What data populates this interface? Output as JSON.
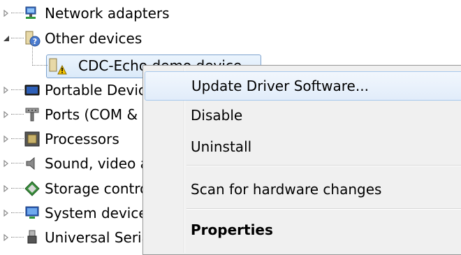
{
  "tree": {
    "items": [
      {
        "label": "Network adapters",
        "icon": "network-adapter-icon",
        "expanded": false
      },
      {
        "label": "Other devices",
        "icon": "unknown-device-icon",
        "expanded": true
      },
      {
        "label": "CDC-Echo demo device",
        "icon": "warning-device-icon",
        "child": true
      },
      {
        "label": "Portable Devices",
        "icon": "portable-device-icon",
        "expanded": false
      },
      {
        "label": "Ports (COM & LPT)",
        "icon": "port-icon",
        "expanded": false
      },
      {
        "label": "Processors",
        "icon": "processor-icon",
        "expanded": false
      },
      {
        "label": "Sound, video and game controllers",
        "icon": "speaker-icon",
        "expanded": false
      },
      {
        "label": "Storage controllers",
        "icon": "storage-icon",
        "expanded": false
      },
      {
        "label": "System devices",
        "icon": "system-device-icon",
        "expanded": false
      },
      {
        "label": "Universal Serial Bus controllers",
        "icon": "usb-icon",
        "expanded": false
      }
    ]
  },
  "context_menu": {
    "items": [
      {
        "label": "Update Driver Software...",
        "highlighted": true
      },
      {
        "label": "Disable"
      },
      {
        "label": "Uninstall"
      },
      {
        "label": "Scan for hardware changes"
      },
      {
        "label": "Properties",
        "bold": true
      }
    ]
  },
  "colors": {
    "selection_border": "#7da2ce",
    "menu_background": "#f0f0f0",
    "menu_highlight_border": "#a8c8ec",
    "warning": "#f5c400"
  }
}
